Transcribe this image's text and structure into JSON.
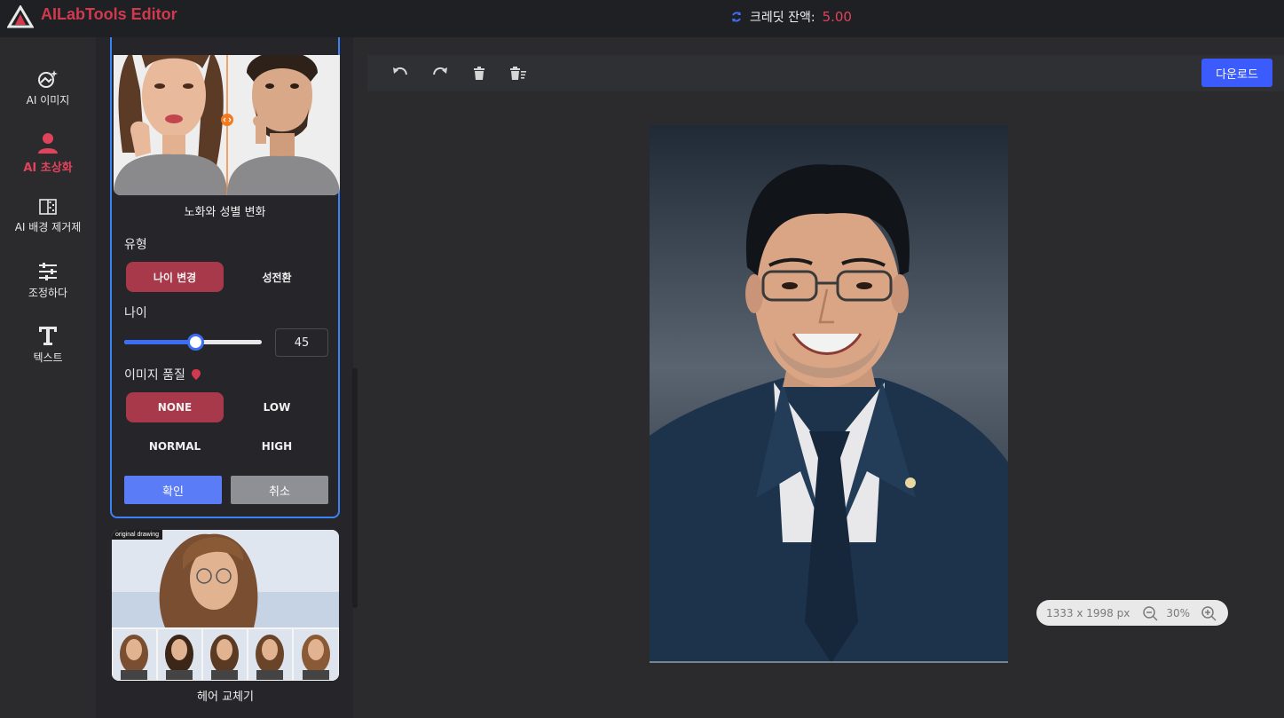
{
  "app": {
    "brand": "AILabTools Editor",
    "logo_icon": "ailabtools-logo-icon",
    "credit_label": "크레딧 잔액:",
    "credit_value": "5.00"
  },
  "nav": {
    "items": [
      {
        "label": "AI 이미지",
        "icon": "ai-image-icon"
      },
      {
        "label": "AI 초상화",
        "icon": "person-icon",
        "active": true
      },
      {
        "label": "AI 배경 제거제",
        "icon": "background-remove-icon"
      },
      {
        "label": "조정하다",
        "icon": "sliders-icon"
      },
      {
        "label": "텍스트",
        "icon": "text-icon"
      }
    ]
  },
  "panel": {
    "card_title": "노화와 성별 변화",
    "type_label": "유형",
    "type_options": [
      "나이 변경",
      "성전환"
    ],
    "age_label": "나이",
    "age_value": "45",
    "age_fraction": 0.52,
    "quality_label": "이미지 품질",
    "quality_options": [
      "NONE",
      "LOW",
      "NORMAL",
      "HIGH"
    ],
    "confirm": "확인",
    "cancel": "취소",
    "card2_tag": "original drawing",
    "card2_title": "헤어 교체기"
  },
  "toolbar": {
    "icons": [
      "undo-icon",
      "redo-icon",
      "delete-icon",
      "clear-all-icon"
    ],
    "download": "다운로드"
  },
  "canvas": {
    "dims": "1333 x 1998 px",
    "zoom": "30%"
  },
  "colors": {
    "accent": "#e0435c",
    "primary_blue": "#3b5bfd",
    "active_option": "#a8394b"
  }
}
